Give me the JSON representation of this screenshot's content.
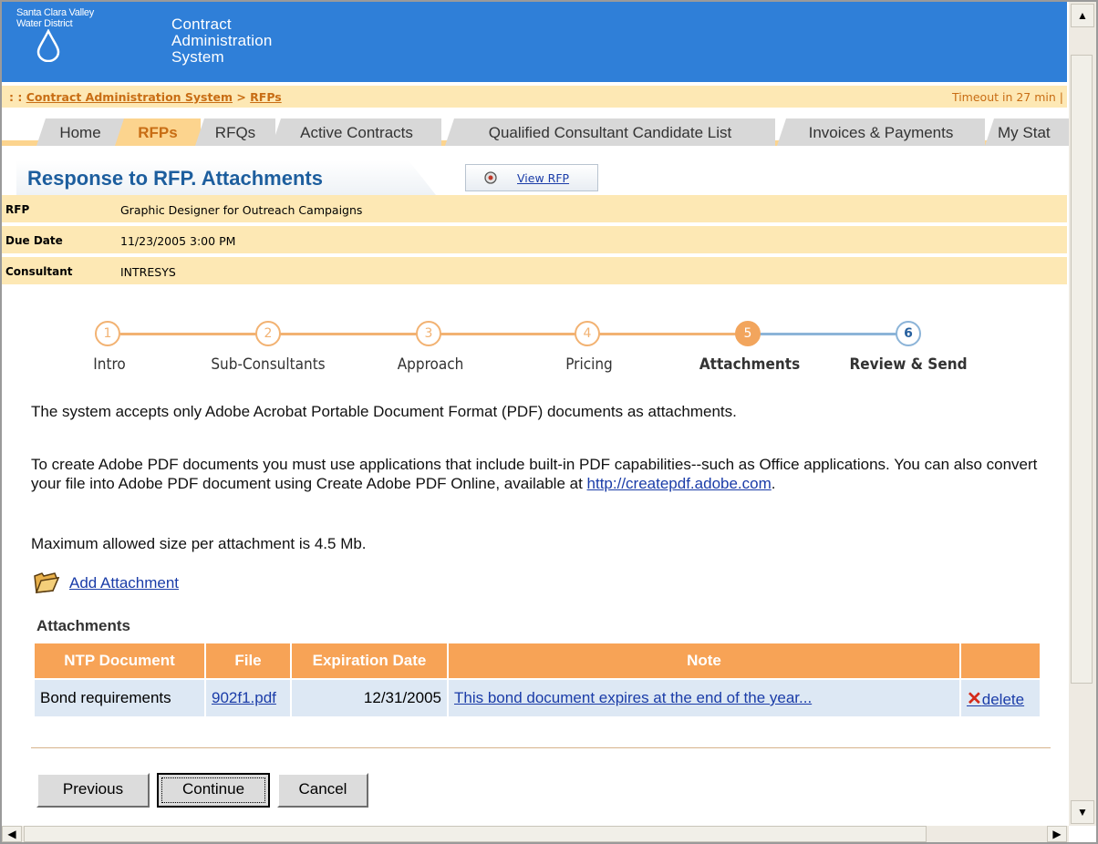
{
  "header": {
    "logo_line1": "Santa Clara Valley",
    "logo_line2": "Water District",
    "app_title_1": "Contract",
    "app_title_2": "Administration",
    "app_title_3": "System"
  },
  "breadcrumb": {
    "prefix": ": : ",
    "root": "Contract Administration System",
    "separator": " > ",
    "current": "RFPs",
    "timeout": "Timeout in 27 min |"
  },
  "tabs": [
    "Home",
    "RFPs",
    "RFQs",
    "Active Contracts",
    "Qualified Consultant Candidate List",
    "Invoices & Payments",
    "My Stat"
  ],
  "page": {
    "title": "Response to RFP. Attachments",
    "view_rfp": "View RFP"
  },
  "info": {
    "rfp_label": "RFP",
    "rfp_value": "Graphic Designer for Outreach Campaigns",
    "due_label": "Due Date",
    "due_value": "11/23/2005 3:00 PM",
    "consultant_label": "Consultant",
    "consultant_value": "INTRESYS"
  },
  "steps": [
    {
      "num": "1",
      "label": "Intro"
    },
    {
      "num": "2",
      "label": "Sub-Consultants"
    },
    {
      "num": "3",
      "label": "Approach"
    },
    {
      "num": "4",
      "label": "Pricing"
    },
    {
      "num": "5",
      "label": "Attachments"
    },
    {
      "num": "6",
      "label": "Review & Send"
    }
  ],
  "body": {
    "para1": "The system accepts only Adobe Acrobat Portable Document Format (PDF) documents as attachments.",
    "para2": "To create Adobe PDF documents you must use applications that include built-in PDF capabilities--such as Office applications. You can also convert your file into Adobe PDF document using Create Adobe PDF Online, available at ",
    "para2_link": "http://createpdf.adobe.com",
    "para2_end": ".",
    "para3": "Maximum allowed size per attachment is 4.5 Mb.",
    "add_attachment": "Add Attachment"
  },
  "attachments": {
    "title": "Attachments",
    "columns": [
      "NTP Document",
      "File",
      "Expiration Date",
      "Note",
      ""
    ],
    "rows": [
      {
        "doc": "Bond requirements",
        "file": "902f1.pdf",
        "expiration": "12/31/2005",
        "note": "This bond document expires at the end of the year...",
        "action": "delete",
        "action_mark": "✕"
      }
    ]
  },
  "buttons": {
    "previous": "Previous",
    "continue": "Continue",
    "cancel": "Cancel"
  },
  "colors": {
    "header_blue": "#2f7fd8",
    "accent_orange": "#f7a356",
    "bar_yellow": "#fde8b4"
  }
}
